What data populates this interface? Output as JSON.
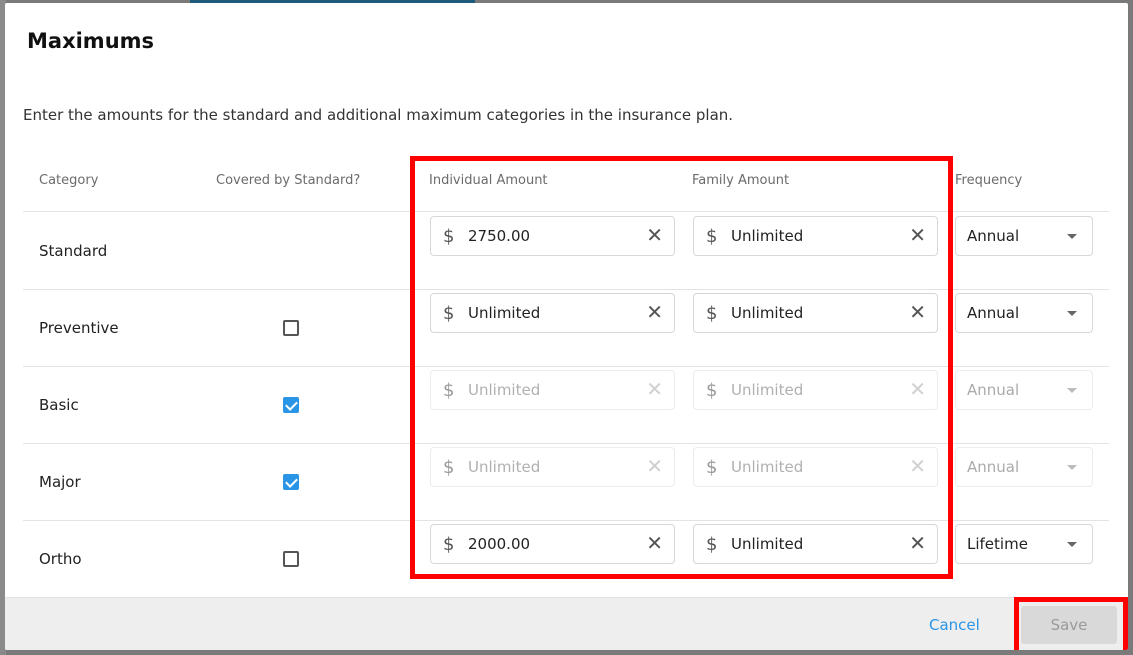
{
  "modal": {
    "title": "Maximums",
    "description": "Enter the amounts for the standard and additional maximum categories in the insurance plan."
  },
  "table": {
    "headers": {
      "category": "Category",
      "covered": "Covered by Standard?",
      "individual": "Individual Amount",
      "family": "Family Amount",
      "frequency": "Frequency"
    },
    "currency_symbol": "$",
    "clear_glyph": "✕",
    "rows": [
      {
        "category": "Standard",
        "covered": null,
        "individual": "2750.00",
        "family": "Unlimited",
        "frequency": "Annual",
        "disabled": false
      },
      {
        "category": "Preventive",
        "covered": false,
        "individual": "Unlimited",
        "family": "Unlimited",
        "frequency": "Annual",
        "disabled": false
      },
      {
        "category": "Basic",
        "covered": true,
        "individual": "Unlimited",
        "family": "Unlimited",
        "frequency": "Annual",
        "disabled": true
      },
      {
        "category": "Major",
        "covered": true,
        "individual": "Unlimited",
        "family": "Unlimited",
        "frequency": "Annual",
        "disabled": true
      },
      {
        "category": "Ortho",
        "covered": false,
        "individual": "2000.00",
        "family": "Unlimited",
        "frequency": "Lifetime",
        "disabled": false
      }
    ]
  },
  "footer": {
    "cancel_label": "Cancel",
    "save_label": "Save"
  },
  "colors": {
    "accent": "#2a95e6",
    "highlight": "#ff0000"
  },
  "icons": {
    "dollar": "dollar-icon",
    "clear": "close-icon",
    "caret": "chevron-down-icon",
    "check": "checkmark-icon"
  }
}
